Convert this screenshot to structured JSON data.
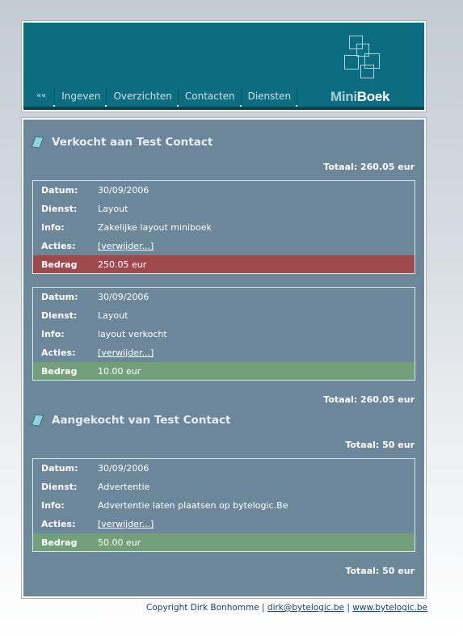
{
  "nav": {
    "back": "««",
    "items": [
      "Ingeven",
      "Overzichten",
      "Contacten",
      "Diensten"
    ]
  },
  "logo": {
    "mini": "Mini",
    "boek": "Boek"
  },
  "sections": [
    {
      "title": "Verkocht aan Test Contact",
      "total_top": "Totaal: 260.05 eur",
      "total_bottom": "Totaal: 260.05 eur",
      "entries": [
        {
          "datum_label": "Datum:",
          "datum": "30/09/2006",
          "dienst_label": "Dienst:",
          "dienst": "Layout",
          "info_label": "Info:",
          "info": "Zakelijke layout miniboek",
          "acties_label": "Acties:",
          "acties": "[verwijder...]",
          "bedrag_label": "Bedrag",
          "bedrag": "250.05 eur",
          "bedrag_color": "#9e4a4d"
        },
        {
          "datum_label": "Datum:",
          "datum": "30/09/2006",
          "dienst_label": "Dienst:",
          "dienst": "Layout",
          "info_label": "Info:",
          "info": "layout verkocht",
          "acties_label": "Acties:",
          "acties": "[verwijder...]",
          "bedrag_label": "Bedrag",
          "bedrag": "10.00 eur",
          "bedrag_color": "#73a07a"
        }
      ]
    },
    {
      "title": "Aangekocht van Test Contact",
      "total_top": "Totaal: 50 eur",
      "total_bottom": "Totaal: 50 eur",
      "entries": [
        {
          "datum_label": "Datum:",
          "datum": "30/09/2006",
          "dienst_label": "Dienst:",
          "dienst": "Advertentie",
          "info_label": "Info:",
          "info": "Advertentie laten plaatsen op bytelogic.Be",
          "acties_label": "Acties:",
          "acties": "[verwijder...]",
          "bedrag_label": "Bedrag",
          "bedrag": "50.00 eur",
          "bedrag_color": "#73a07a"
        }
      ]
    }
  ],
  "footer": {
    "copyright": "Copyright Dirk Bonhomme | ",
    "email": "dirk@bytelogic.be",
    "separator": " | ",
    "website": "www.bytelogic.be"
  },
  "colors": {
    "header": "#0c6d80",
    "content": "#6c8799",
    "red": "#9e4a4d",
    "green": "#73a07a"
  }
}
